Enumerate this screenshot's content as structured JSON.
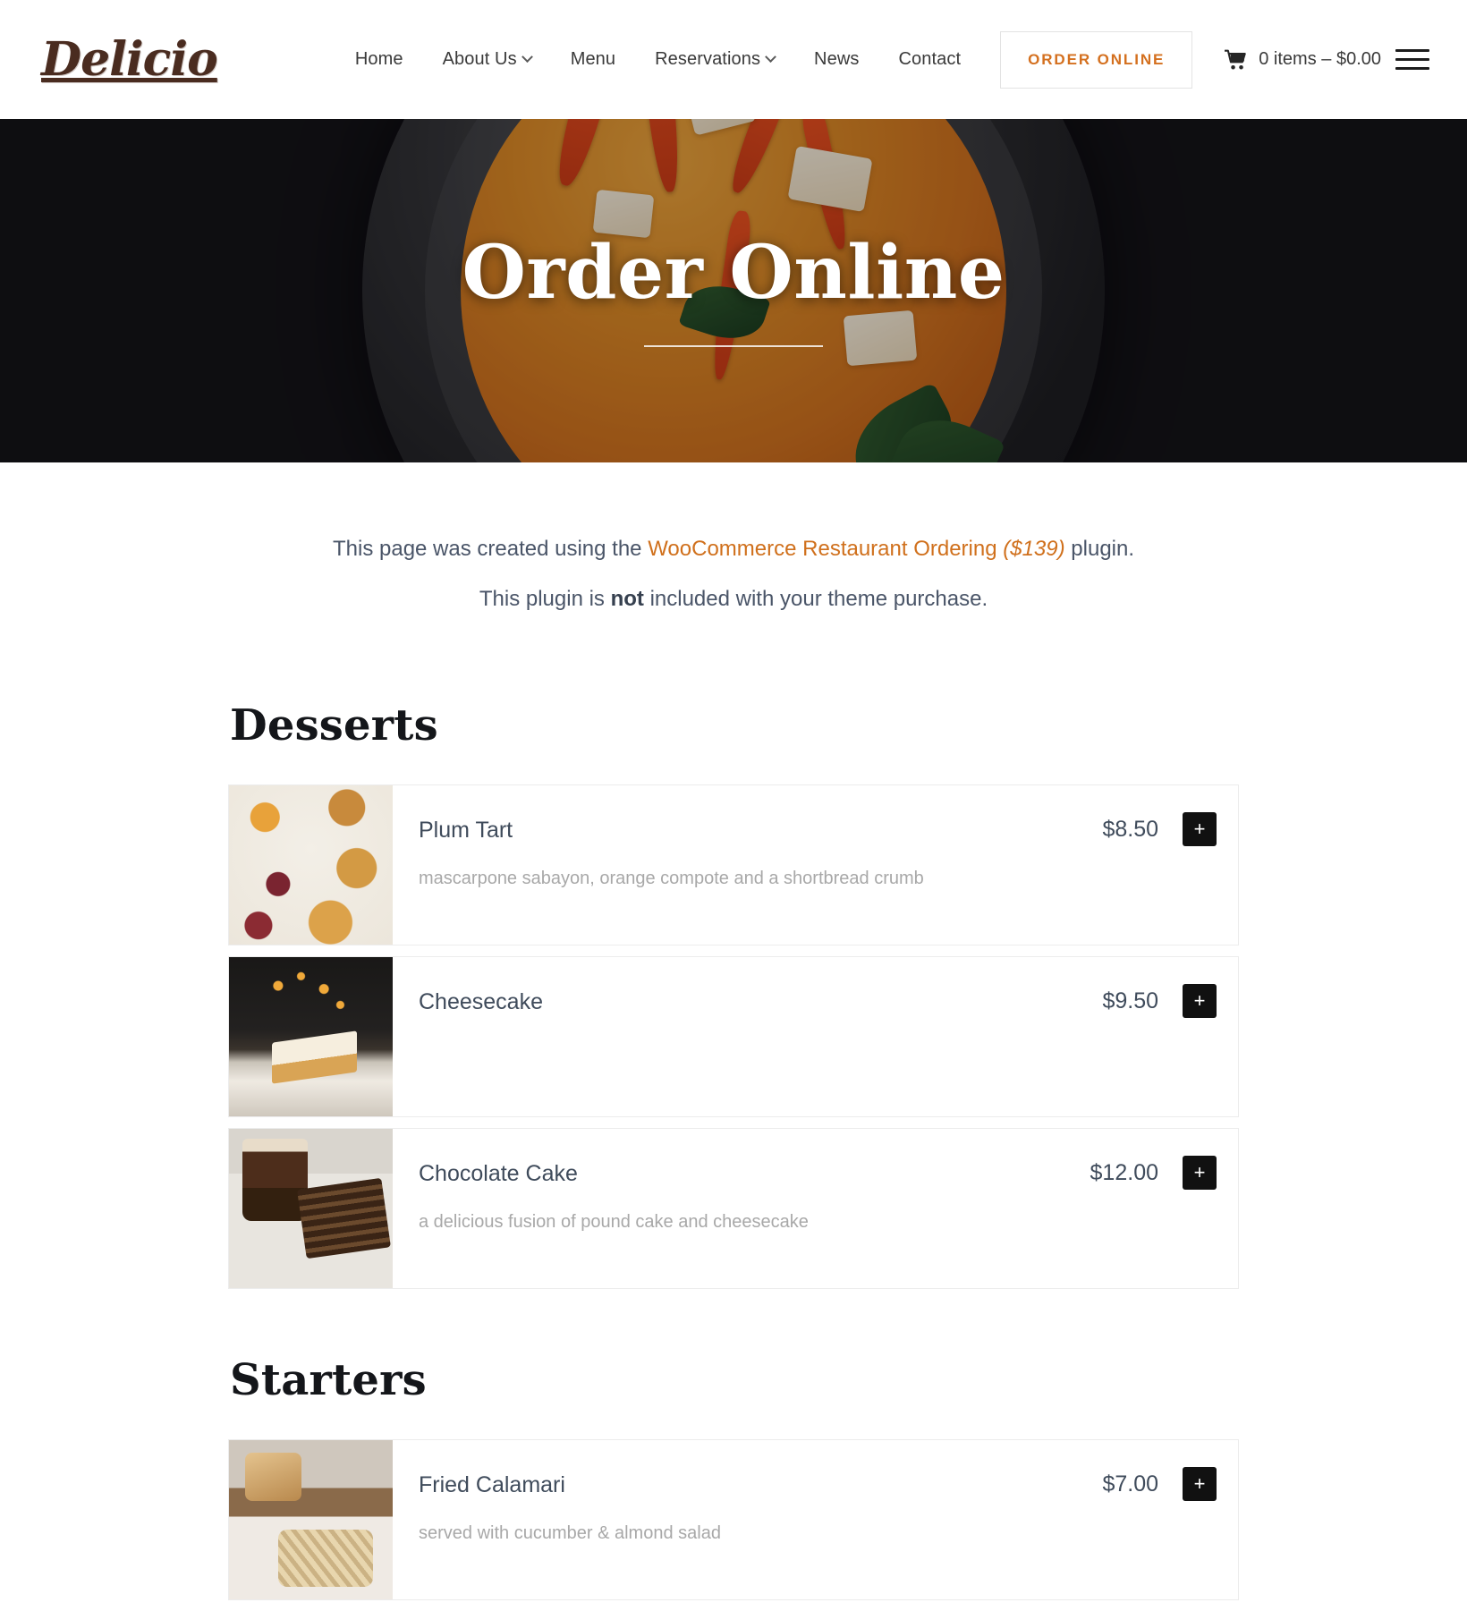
{
  "header": {
    "brand": "Delicio",
    "nav": [
      {
        "label": "Home",
        "has_caret": false
      },
      {
        "label": "About Us",
        "has_caret": true
      },
      {
        "label": "Menu",
        "has_caret": false
      },
      {
        "label": "Reservations",
        "has_caret": true
      },
      {
        "label": "News",
        "has_caret": false
      },
      {
        "label": "Contact",
        "has_caret": false
      }
    ],
    "order_button": "ORDER ONLINE",
    "cart_icon": "shopping-cart-icon",
    "cart_text": "0 items – $0.00",
    "menu_icon": "hamburger-menu-icon",
    "accent_color": "#d4701f"
  },
  "hero": {
    "title": "Order Online"
  },
  "notice": {
    "line1_before": "This page was created using the ",
    "line1_link": "WooCommerce Restaurant Ordering",
    "line1_price": " ($139)",
    "line1_after": " plugin.",
    "line2_before": "This plugin is ",
    "line2_strong": "not",
    "line2_after": " included with your theme purchase."
  },
  "menu": {
    "sections": [
      {
        "title": "Desserts",
        "items": [
          {
            "name": "Plum Tart",
            "price": "$8.50",
            "description": "mascarpone sabayon, orange compote and a shortbread crumb",
            "add_label": "+",
            "thumb": "plum-tart-photo"
          },
          {
            "name": "Cheesecake",
            "price": "$9.50",
            "description": "",
            "add_label": "+",
            "thumb": "cheesecake-photo"
          },
          {
            "name": "Chocolate Cake",
            "price": "$12.00",
            "description": "a delicious fusion of pound cake and cheesecake",
            "add_label": "+",
            "thumb": "chocolate-cake-photo"
          }
        ]
      },
      {
        "title": "Starters",
        "items": [
          {
            "name": "Fried Calamari",
            "price": "$7.00",
            "description": "served with cucumber & almond salad",
            "add_label": "+",
            "thumb": "fried-calamari-photo"
          }
        ]
      }
    ]
  }
}
